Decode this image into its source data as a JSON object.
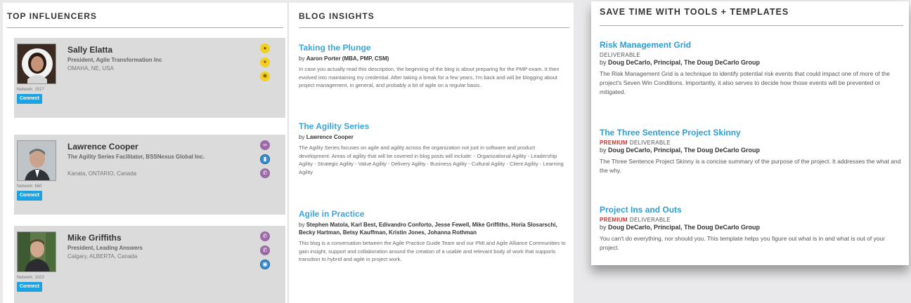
{
  "influencers": {
    "title": "TOP INFLUENCERS",
    "connect_label": "Connect",
    "people": [
      {
        "name": "Sally Elatta",
        "role": "President, Agile Transformation Inc",
        "location": "OMAHA, NE, USA",
        "network": "Network: 1517",
        "badges": [
          "gold-medal-icon",
          "gold-ribbon-icon",
          "gold-network-icon"
        ]
      },
      {
        "name": "Lawrence Cooper",
        "role": "The Agility Series Facilitator, BSSNexus Global Inc.",
        "location": "Kanata, ONTARIO, Canada",
        "network": "Network: 660",
        "badges": [
          "purple-link-icon",
          "purple-chart-icon",
          "purple-phone-icon"
        ]
      },
      {
        "name": "Mike Griffiths",
        "role": "President, Leading Answers",
        "location": "Calgary, ALBERTA, Canada",
        "network": "Network: 1023",
        "badges": [
          "purple-phone-icon",
          "purple-phone-icon",
          "blue-globe-icon"
        ]
      }
    ]
  },
  "blog": {
    "title": "BLOG INSIGHTS",
    "by_prefix": "by",
    "posts": [
      {
        "title": "Taking the Plunge",
        "authors": "Aaron Porter (MBA, PMP, CSM)",
        "description": "In case you actually read this description, the beginning of the blog is about preparing for the PMP exam. It then evolved into maintaining my credential. After taking a break for a few years, I'm back and will be blogging about project management, in general, and probably a bit of agile on a regular basis."
      },
      {
        "title": "The Agility Series",
        "authors": "Lawrence Cooper",
        "description": "The Agility Series focuses on agile and agility across the organization not just in software and product development. Areas of agility that will be covered in blog posts will include: - Organizational Agility - Leadership Agility - Strategic Agility - Value Agility - Delivery Agility - Business Agility - Cultural Agility - Client Agility - Learning Agility"
      },
      {
        "title": "Agile in Practice",
        "authors": "Stephen Matola, Karl Best, Edivandro Conforto, Jesse Fewell, Mike Griffiths, Horia Slosarschi, Becky Hartman, Betsy Kauffman, Kristin Jones, Johanna Rothman",
        "description": "This blog is a conversation between the Agile Practice Guide Team and our PMI and Agile Alliance Communities to gain insight, support and collaboration around the creation of a usable and relevant body of work that supports transition to hybrid and agile in project work."
      }
    ]
  },
  "tools": {
    "title": "SAVE TIME WITH TOOLS + TEMPLATES",
    "by_prefix": "by",
    "deliverable_label": "DELIVERABLE",
    "premium_label": "PREMIUM",
    "items": [
      {
        "title": "Risk Management Grid",
        "author": "Doug DeCarlo, Principal, The Doug DeCarlo Group",
        "description": "The Risk Management Grid is a technique to identify potential risk events that could impact one of more of the project's Seven Win Conditions. Importantly, it also serves to decide how those events will be prevented or mitigated."
      },
      {
        "title": "The Three Sentence Project Skinny",
        "author": "Doug DeCarlo, Principal, The Doug DeCarlo Group",
        "description": "The Three Sentence Project Skinny is a concise summary of the purpose of the project. It addresses the what and the why."
      },
      {
        "title": "Project Ins and Outs",
        "author": "Doug DeCarlo, Principal, The Doug DeCarlo Group",
        "description": "You can't do everything, nor should you. This template helps you figure out what is in and what is out of your project."
      }
    ]
  }
}
